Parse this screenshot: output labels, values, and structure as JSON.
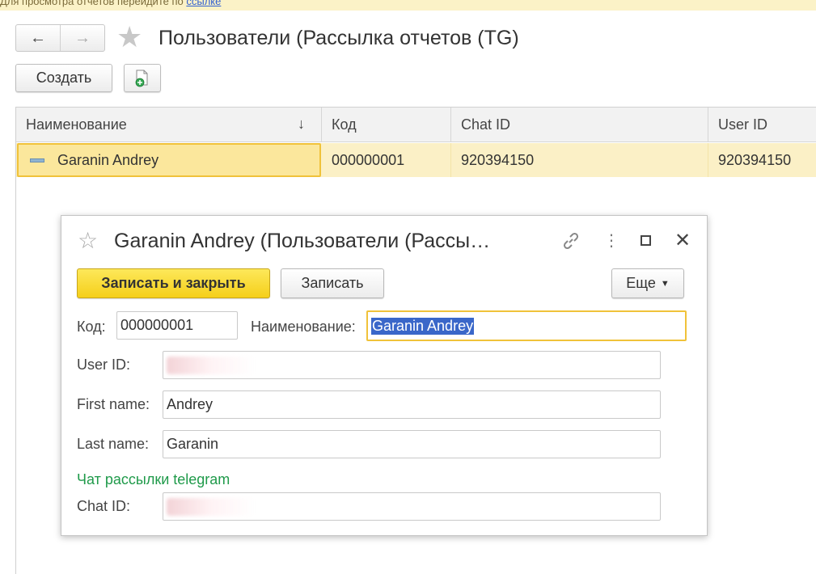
{
  "topbar": {
    "text": "Для просмотра отчетов перейдите по",
    "link": "ссылке"
  },
  "toolbar": {
    "back_label": "←",
    "forward_label": "→",
    "favorite_icon": "star-icon",
    "title": "Пользователи (Рассылка отчетов (TG)",
    "create_label": "Создать",
    "copy_icon": "copy-document-icon"
  },
  "list": {
    "columns": [
      "Наименование",
      "Код",
      "Chat ID",
      "User ID"
    ],
    "sort_indicator": "↓",
    "rows": [
      {
        "name": "Garanin Andrey",
        "code": "000000001",
        "chat_id": "920394150",
        "user_id": "920394150"
      }
    ]
  },
  "dialog": {
    "title": "Garanin Andrey (Пользователи (Рассы…",
    "icons": [
      "star-icon",
      "link-icon",
      "more-vertical-icon",
      "maximize-icon",
      "close-icon"
    ],
    "buttons": {
      "save_close": "Записать и закрыть",
      "save": "Записать",
      "more": "Еще"
    },
    "fields": {
      "code_label": "Код:",
      "code_value": "000000001",
      "name_label": "Наименование:",
      "name_value": "Garanin Andrey",
      "user_id_label": "User ID:",
      "first_name_label": "First name:",
      "first_name_value": "Andrey",
      "last_name_label": "Last name:",
      "last_name_value": "Garanin",
      "section_label": "Чат рассылки telegram",
      "chat_id_label": "Chat ID:"
    }
  },
  "colors": {
    "accent_yellow": "#f5cf1a",
    "selection_row": "#fbf0c6",
    "section_green": "#1f9a4a"
  }
}
